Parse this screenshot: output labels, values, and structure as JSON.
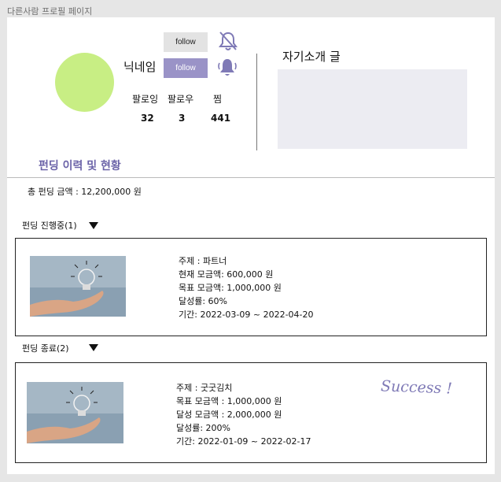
{
  "page_label": "다른사람 프로필 페이지",
  "profile": {
    "nickname": "닉네임",
    "follow_button_outline": "follow",
    "follow_button_filled": "follow",
    "stats": [
      {
        "label": "팔로잉",
        "value": "32"
      },
      {
        "label": "팔로우",
        "value": "3"
      },
      {
        "label": "찜",
        "value": "441"
      }
    ],
    "avatar_color": "#c8ee84"
  },
  "intro": {
    "title": "자기소개 글"
  },
  "funding": {
    "section_title": "펀딩 이력 및 현황",
    "total": "총 펀딩 금액 : 12,200,000 원",
    "in_progress": {
      "label": "펀딩 진행중(1)",
      "lines": [
        "주제 : 파트너",
        "현재 모금액: 600,000 원",
        "목표 모금액: 1,000,000 원",
        "달성률: 60%",
        "기간: 2022-03-09 ~ 2022-04-20"
      ]
    },
    "ended": {
      "label": "펀딩 종료(2)",
      "lines": [
        "주제 : 굿굿김치",
        "목표 모금액 : 1,000,000 원",
        "달성 모금액 : 2,000,000 원",
        "달성률: 200%",
        "기간: 2022-01-09 ~ 2022-02-17"
      ],
      "badge": "Success !"
    }
  },
  "colors": {
    "accent": "#6b63a8",
    "button": "#9a93c7",
    "bell": "#7f7ab6"
  }
}
